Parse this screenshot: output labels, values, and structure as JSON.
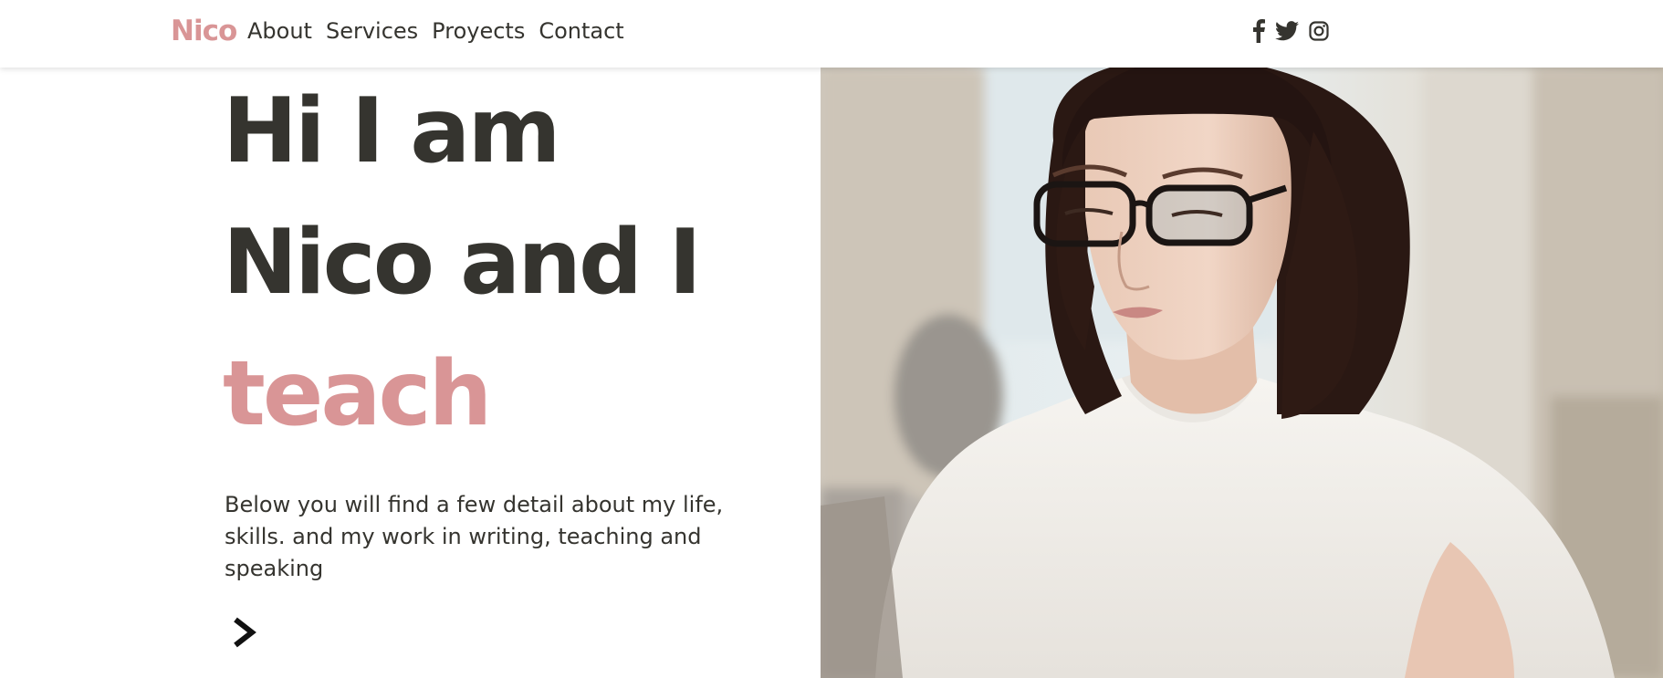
{
  "header": {
    "logo": "Nico",
    "nav": [
      {
        "label": "About"
      },
      {
        "label": "Services"
      },
      {
        "label": "Proyects"
      },
      {
        "label": "Contact"
      }
    ],
    "socials": [
      "facebook-icon",
      "twitter-icon",
      "instagram-icon"
    ]
  },
  "hero": {
    "line1": "Hi I am",
    "line2": "Nico and I",
    "line3": "teach",
    "description": "Below you will find a few detail about my life, skills. and my work in writing, teaching and speaking",
    "next_icon": "chevron-right-icon"
  },
  "colors": {
    "accent": "#d99596",
    "text": "#35342f",
    "background": "#ffffff"
  }
}
